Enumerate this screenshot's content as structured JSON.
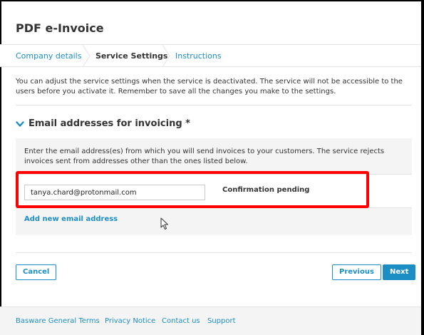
{
  "header": {
    "title": "PDF e-Invoice"
  },
  "tabs": [
    {
      "label": "Company details",
      "active": false
    },
    {
      "label": "Service Settings",
      "active": true
    },
    {
      "label": "Instructions",
      "active": false
    }
  ],
  "intro_text": "You can adjust the service settings when the service is deactivated. The service will not be accessible to the users before you activate it. Remember to save all the changes you make to the settings.",
  "section": {
    "title": "Email addresses for invoicing *",
    "description": "Enter the email address(es) from which you will send invoices to your customers. The service rejects invoices sent from addresses other than the ones listed below.",
    "emails": [
      {
        "value": "tanya.chard@protonmail.com",
        "status": "Confirmation pending"
      }
    ],
    "add_label": "Add new email address"
  },
  "actions": {
    "cancel_label": "Cancel",
    "previous_label": "Previous",
    "next_label": "Next"
  },
  "footer": {
    "links": [
      "Basware General Terms",
      "Privacy Notice",
      "Contact us",
      "Support"
    ]
  },
  "colors": {
    "accent": "#1d8ec4",
    "highlight": "#ff0000",
    "panel_bg": "#f4f4f4"
  },
  "icons": {
    "section_toggle": "chevron-down-icon",
    "tab_separator": "chevron-right-icon",
    "cursor": "mouse-pointer-icon"
  }
}
